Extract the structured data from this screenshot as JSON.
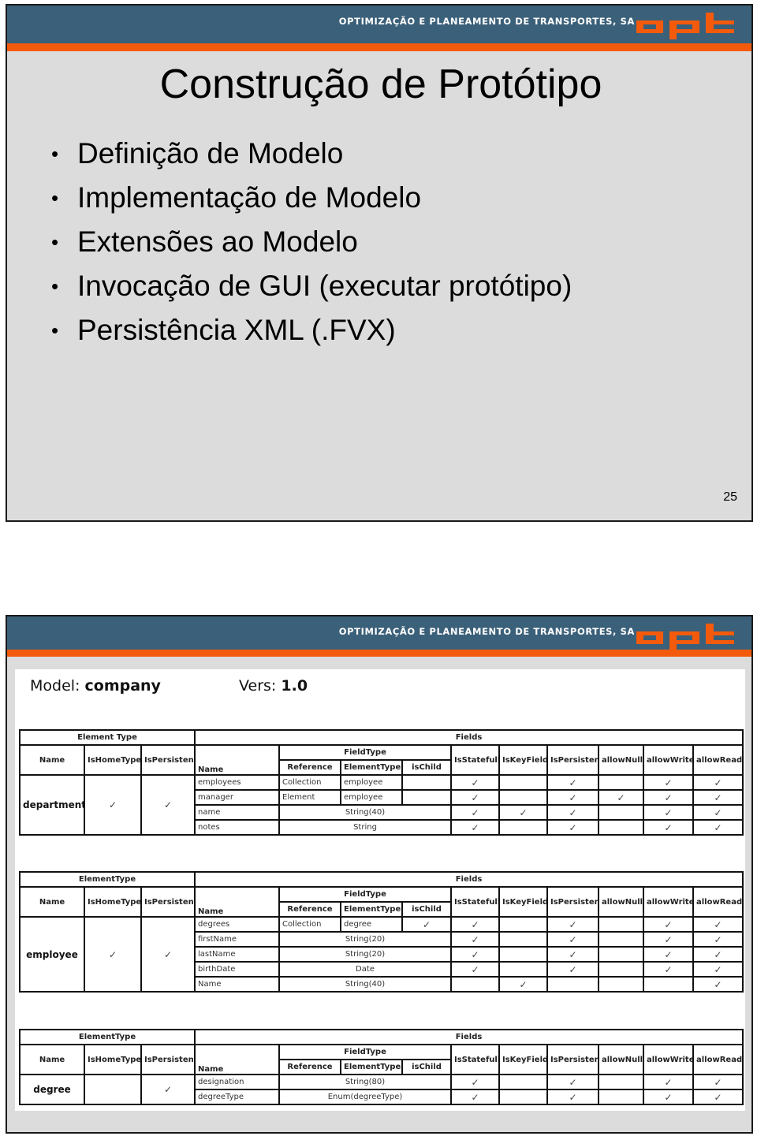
{
  "slide1": {
    "header": {
      "company": "OPTIMIZAÇÃO E PLANEAMENTO DE TRANSPORTES, SA",
      "logo": "opt"
    },
    "title": "Construção de Protótipo",
    "bullets": [
      "Definição de Modelo",
      "Implementação de Modelo",
      "Extensões ao Modelo",
      "Invocação de GUI (executar protótipo)",
      "Persistência XML (.FVX)"
    ],
    "page_number": "25"
  },
  "slide2": {
    "header": {
      "company": "OPTIMIZAÇÃO E PLANEAMENTO DE TRANSPORTES, SA",
      "logo": "opt"
    },
    "model_label": "Model:",
    "model_name": "company",
    "version_label": "Vers:",
    "version": "1.0",
    "check_glyph": "✓",
    "columns": {
      "fields_group": "Fields",
      "name": "Name",
      "is_home_type": "IsHomeType",
      "is_persistent": "IsPersistent",
      "field_name": "Name",
      "field_type": "FieldType",
      "reference": "Reference",
      "element_type": "ElementType",
      "is_child": "isChild",
      "is_statefull": "IsStatefull",
      "is_key_field": "IsKeyField",
      "field_is_persistent": "IsPersistent",
      "allow_null": "allowNull",
      "allow_write": "allowWrite",
      "allow_read": "allowRead"
    },
    "tables": [
      {
        "group_title": "Element Type",
        "name": "department",
        "is_home_type": true,
        "is_persistent": true,
        "fields": [
          {
            "name": "employees",
            "reference": "Collection",
            "element_type": "employee",
            "type": "",
            "is_child": false,
            "statefull": true,
            "key": false,
            "persistent": true,
            "null": false,
            "write": true,
            "read": true
          },
          {
            "name": "manager",
            "reference": "Element",
            "element_type": "employee",
            "type": "",
            "is_child": false,
            "statefull": true,
            "key": false,
            "persistent": true,
            "null": true,
            "write": true,
            "read": true
          },
          {
            "name": "name",
            "type": "String(40)",
            "statefull": true,
            "key": true,
            "persistent": true,
            "null": false,
            "write": true,
            "read": true
          },
          {
            "name": "notes",
            "type": "String",
            "statefull": true,
            "key": false,
            "persistent": true,
            "null": false,
            "write": true,
            "read": true
          }
        ]
      },
      {
        "group_title": "ElementType",
        "name": "employee",
        "is_home_type": true,
        "is_persistent": true,
        "fields": [
          {
            "name": "degrees",
            "reference": "Collection",
            "element_type": "degree",
            "type": "",
            "is_child": true,
            "statefull": true,
            "key": false,
            "persistent": true,
            "null": false,
            "write": true,
            "read": true
          },
          {
            "name": "firstName",
            "type": "String(20)",
            "statefull": true,
            "key": false,
            "persistent": true,
            "null": false,
            "write": true,
            "read": true
          },
          {
            "name": "lastName",
            "type": "String(20)",
            "statefull": true,
            "key": false,
            "persistent": true,
            "null": false,
            "write": true,
            "read": true
          },
          {
            "name": "birthDate",
            "type": "Date",
            "statefull": true,
            "key": false,
            "persistent": true,
            "null": false,
            "write": true,
            "read": true
          },
          {
            "name": "Name",
            "type": "String(40)",
            "statefull": false,
            "key": true,
            "persistent": false,
            "null": false,
            "write": false,
            "read": true
          }
        ]
      },
      {
        "group_title": "ElementType",
        "name": "degree",
        "is_home_type": false,
        "is_persistent": true,
        "fields": [
          {
            "name": "designation",
            "type": "String(80)",
            "statefull": true,
            "key": false,
            "persistent": true,
            "null": false,
            "write": true,
            "read": true
          },
          {
            "name": "degreeType",
            "type": "Enum(degreeType)",
            "statefull": true,
            "key": false,
            "persistent": true,
            "null": false,
            "write": true,
            "read": true
          }
        ]
      }
    ]
  },
  "colors": {
    "banner": "#3b6079",
    "accent": "#f45a0c",
    "slide_bg": "#dcdcdc"
  }
}
